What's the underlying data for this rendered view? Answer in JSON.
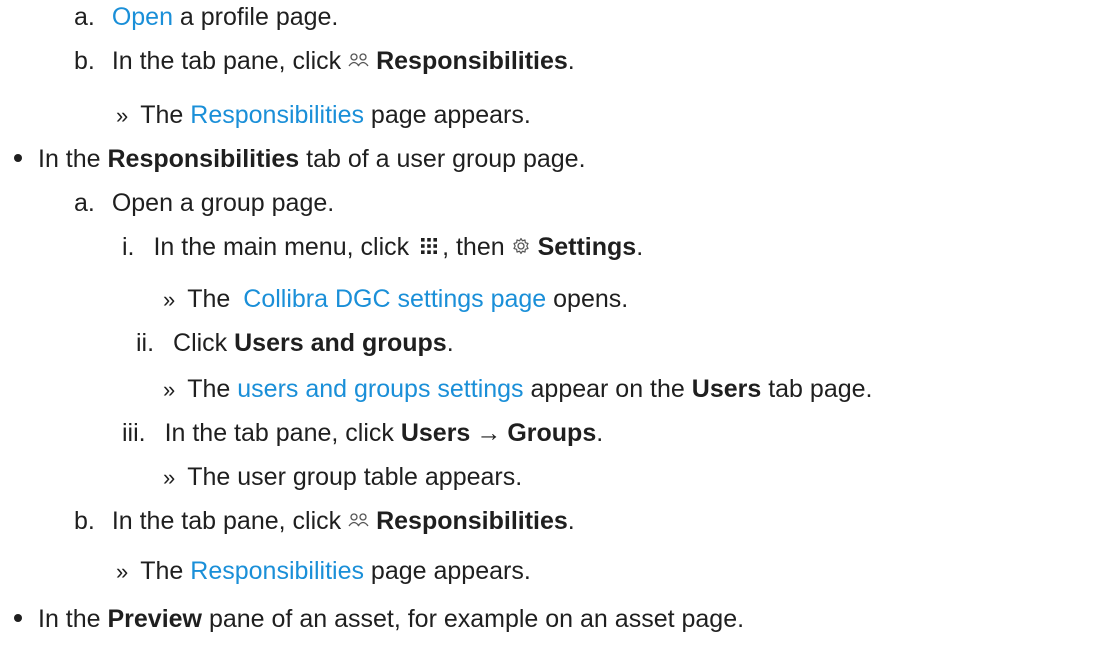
{
  "items": {
    "a1": {
      "marker": "a.",
      "link": "Open",
      "text": " a profile page."
    },
    "b1": {
      "marker": "b.",
      "pre": "In the tab pane, click ",
      "bold": "Responsibilities",
      "post": "."
    },
    "b1_result": {
      "marker": "»",
      "pre": "The ",
      "link": "Responsibilities",
      "post": " page appears."
    },
    "bullet2": {
      "pre": "In the ",
      "bold": "Responsibilities",
      "post": " tab of a user group page."
    },
    "a2": {
      "marker": "a.",
      "text": "Open a group page."
    },
    "i": {
      "marker": "i.",
      "pre": "In the main menu, click ",
      "mid": ", then ",
      "bold": "Settings",
      "post": "."
    },
    "i_result": {
      "marker": "»",
      "pre": "The ",
      "link": "Collibra DGC settings page",
      "post": " opens."
    },
    "ii": {
      "marker": "ii.",
      "pre": "Click ",
      "bold": "Users and groups",
      "post": "."
    },
    "ii_result": {
      "marker": "»",
      "pre": "The ",
      "link": "users and groups settings",
      "mid": " appear on the ",
      "bold": "Users",
      "post": " tab page."
    },
    "iii": {
      "marker": "iii.",
      "pre": "In the tab pane, click ",
      "bold1": "Users",
      "arrow": "→",
      "bold2": "Groups",
      "post": "."
    },
    "iii_result": {
      "marker": "»",
      "text": "The user group table appears."
    },
    "b2": {
      "marker": "b.",
      "pre": "In the tab pane, click ",
      "bold": "Responsibilities",
      "post": "."
    },
    "b2_result": {
      "marker": "»",
      "pre": "The ",
      "link": "Responsibilities",
      "post": " page appears."
    },
    "bullet3": {
      "pre": "In the ",
      "bold": "Preview",
      "post": " pane of an asset, for example on an asset page."
    }
  },
  "icons": {
    "people": "people-icon",
    "grid": "app-grid-icon",
    "gear": "gear-icon"
  },
  "colors": {
    "link": "#1a8fd8",
    "text": "#1f1f1f",
    "icon": "#555555"
  }
}
